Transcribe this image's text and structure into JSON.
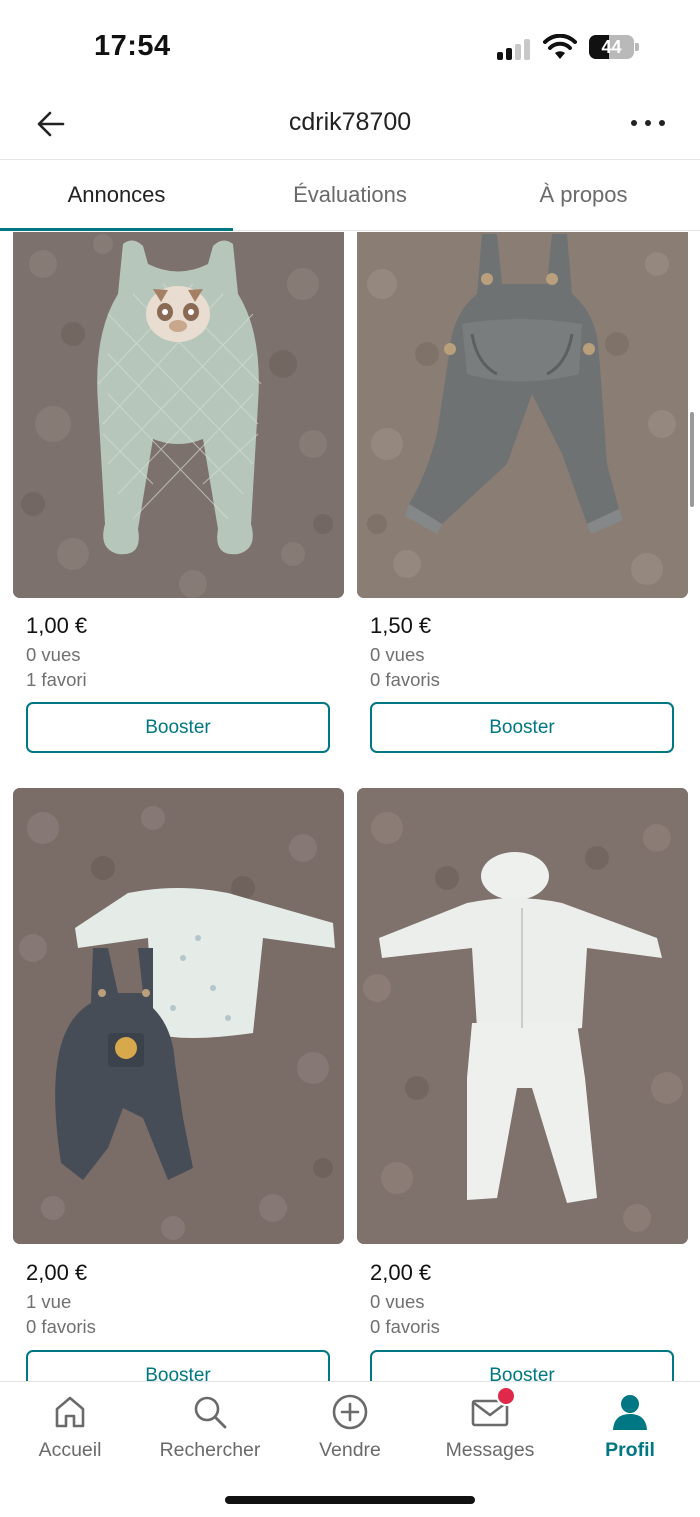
{
  "status_bar": {
    "time": "17:54",
    "battery_level": "44"
  },
  "header": {
    "title": "cdrik78700"
  },
  "tabs": [
    {
      "label": "Annonces",
      "active": true
    },
    {
      "label": "Évaluations",
      "active": false
    },
    {
      "label": "À propos",
      "active": false
    }
  ],
  "items": [
    {
      "price": "1,00 €",
      "views": "0 vues",
      "favorites": "1 favori",
      "boost_label": "Booster",
      "photo": "mint quilted baby sleepsuit with chipmunk patch"
    },
    {
      "price": "1,50 €",
      "views": "0 vues",
      "favorites": "0 favoris",
      "boost_label": "Booster",
      "photo": "grey fleece baby dungarees with pocket"
    },
    {
      "price": "2,00 €",
      "views": "1 vue",
      "favorites": "0 favoris",
      "boost_label": "Booster",
      "photo": "white top and navy Winnie the Pooh dungarees"
    },
    {
      "price": "2,00 €",
      "views": "0 vues",
      "favorites": "0 favoris",
      "boost_label": "Booster",
      "photo": "white ribbed cardigan, trousers and hat set"
    }
  ],
  "bottom_nav": [
    {
      "label": "Accueil",
      "icon": "home-icon",
      "active": false
    },
    {
      "label": "Rechercher",
      "icon": "search-icon",
      "active": false
    },
    {
      "label": "Vendre",
      "icon": "plus-circle-icon",
      "active": false
    },
    {
      "label": "Messages",
      "icon": "mail-icon",
      "active": false,
      "has_notification": true
    },
    {
      "label": "Profil",
      "icon": "profile-icon",
      "active": true
    }
  ],
  "colors": {
    "accent": "#007782",
    "notification": "#e0294a",
    "muted_text": "#707070"
  }
}
